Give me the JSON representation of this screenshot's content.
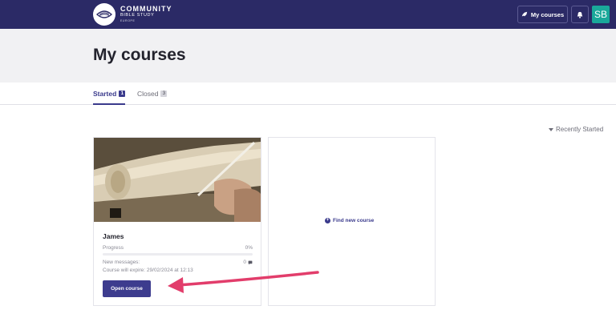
{
  "header": {
    "brand": {
      "line1": "COMMUNITY",
      "line2": "BIBLE STUDY",
      "line3": "EUROPE"
    },
    "my_courses_button": "My courses",
    "avatar_initials": "SB"
  },
  "page": {
    "title": "My courses"
  },
  "tabs": [
    {
      "label": "Started",
      "count": "1",
      "active": true
    },
    {
      "label": "Closed",
      "count": "3",
      "active": false
    }
  ],
  "sort": {
    "label": "Recently Started"
  },
  "course_card": {
    "title": "James",
    "progress_label": "Progress",
    "progress_value": "0%",
    "progress_fraction": 0,
    "messages_label": "New messages:",
    "messages_count": "0",
    "expire_text": "Course will expire: 29/02/2024 at 12:13",
    "open_button": "Open course"
  },
  "find_card": {
    "link_label": "Find new course"
  },
  "colors": {
    "navbar": "#2b2a66",
    "accent": "#3a3a8c",
    "avatar": "#1aa89a",
    "annotation_arrow": "#e23d6b"
  },
  "icons": [
    "rocket-icon",
    "bell-icon",
    "comment-icon",
    "plus-circle-icon",
    "caret-down-icon"
  ]
}
